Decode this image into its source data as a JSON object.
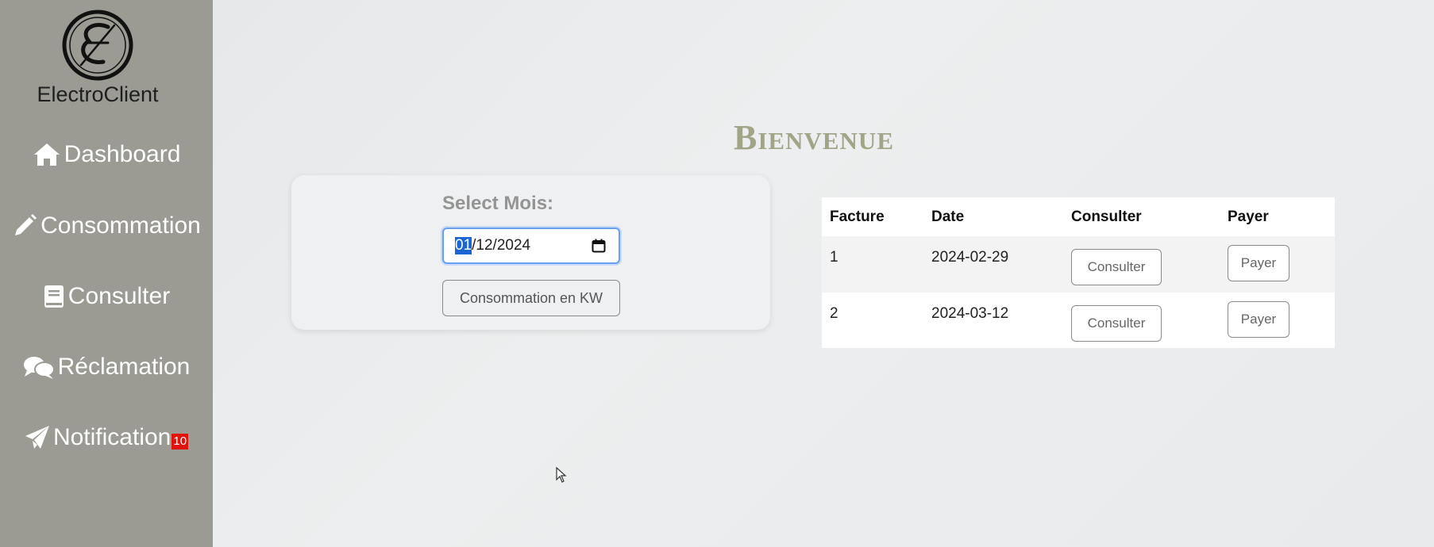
{
  "sidebar": {
    "brand": "ElectroClient",
    "logo_letter": "E",
    "items": [
      {
        "label": "Dashboard",
        "icon": "home-icon"
      },
      {
        "label": "Consommation",
        "icon": "pencil-icon"
      },
      {
        "label": "Consulter",
        "icon": "book-icon"
      },
      {
        "label": "Réclamation",
        "icon": "chat-bubbles-icon"
      },
      {
        "label": "Notification",
        "icon": "paper-plane-icon",
        "badge": "10"
      }
    ]
  },
  "main": {
    "title": "Bienvenue",
    "form": {
      "select_label": "Select Mois:",
      "date_day": "01",
      "date_rest": "/12/2024",
      "button_label": "Consommation en KW"
    },
    "table": {
      "headers": [
        "Facture",
        "Date",
        "Consulter",
        "Payer"
      ],
      "rows": [
        {
          "facture": "1",
          "date": "2024-02-29",
          "consulter": "Consulter",
          "payer": "Payer"
        },
        {
          "facture": "2",
          "date": "2024-03-12",
          "consulter": "Consulter",
          "payer": "Payer"
        }
      ]
    }
  },
  "colors": {
    "sidebar_bg": "#9b9b93",
    "title": "#a1a487",
    "badge": "#e0140c",
    "focus": "#6a9ef0"
  }
}
